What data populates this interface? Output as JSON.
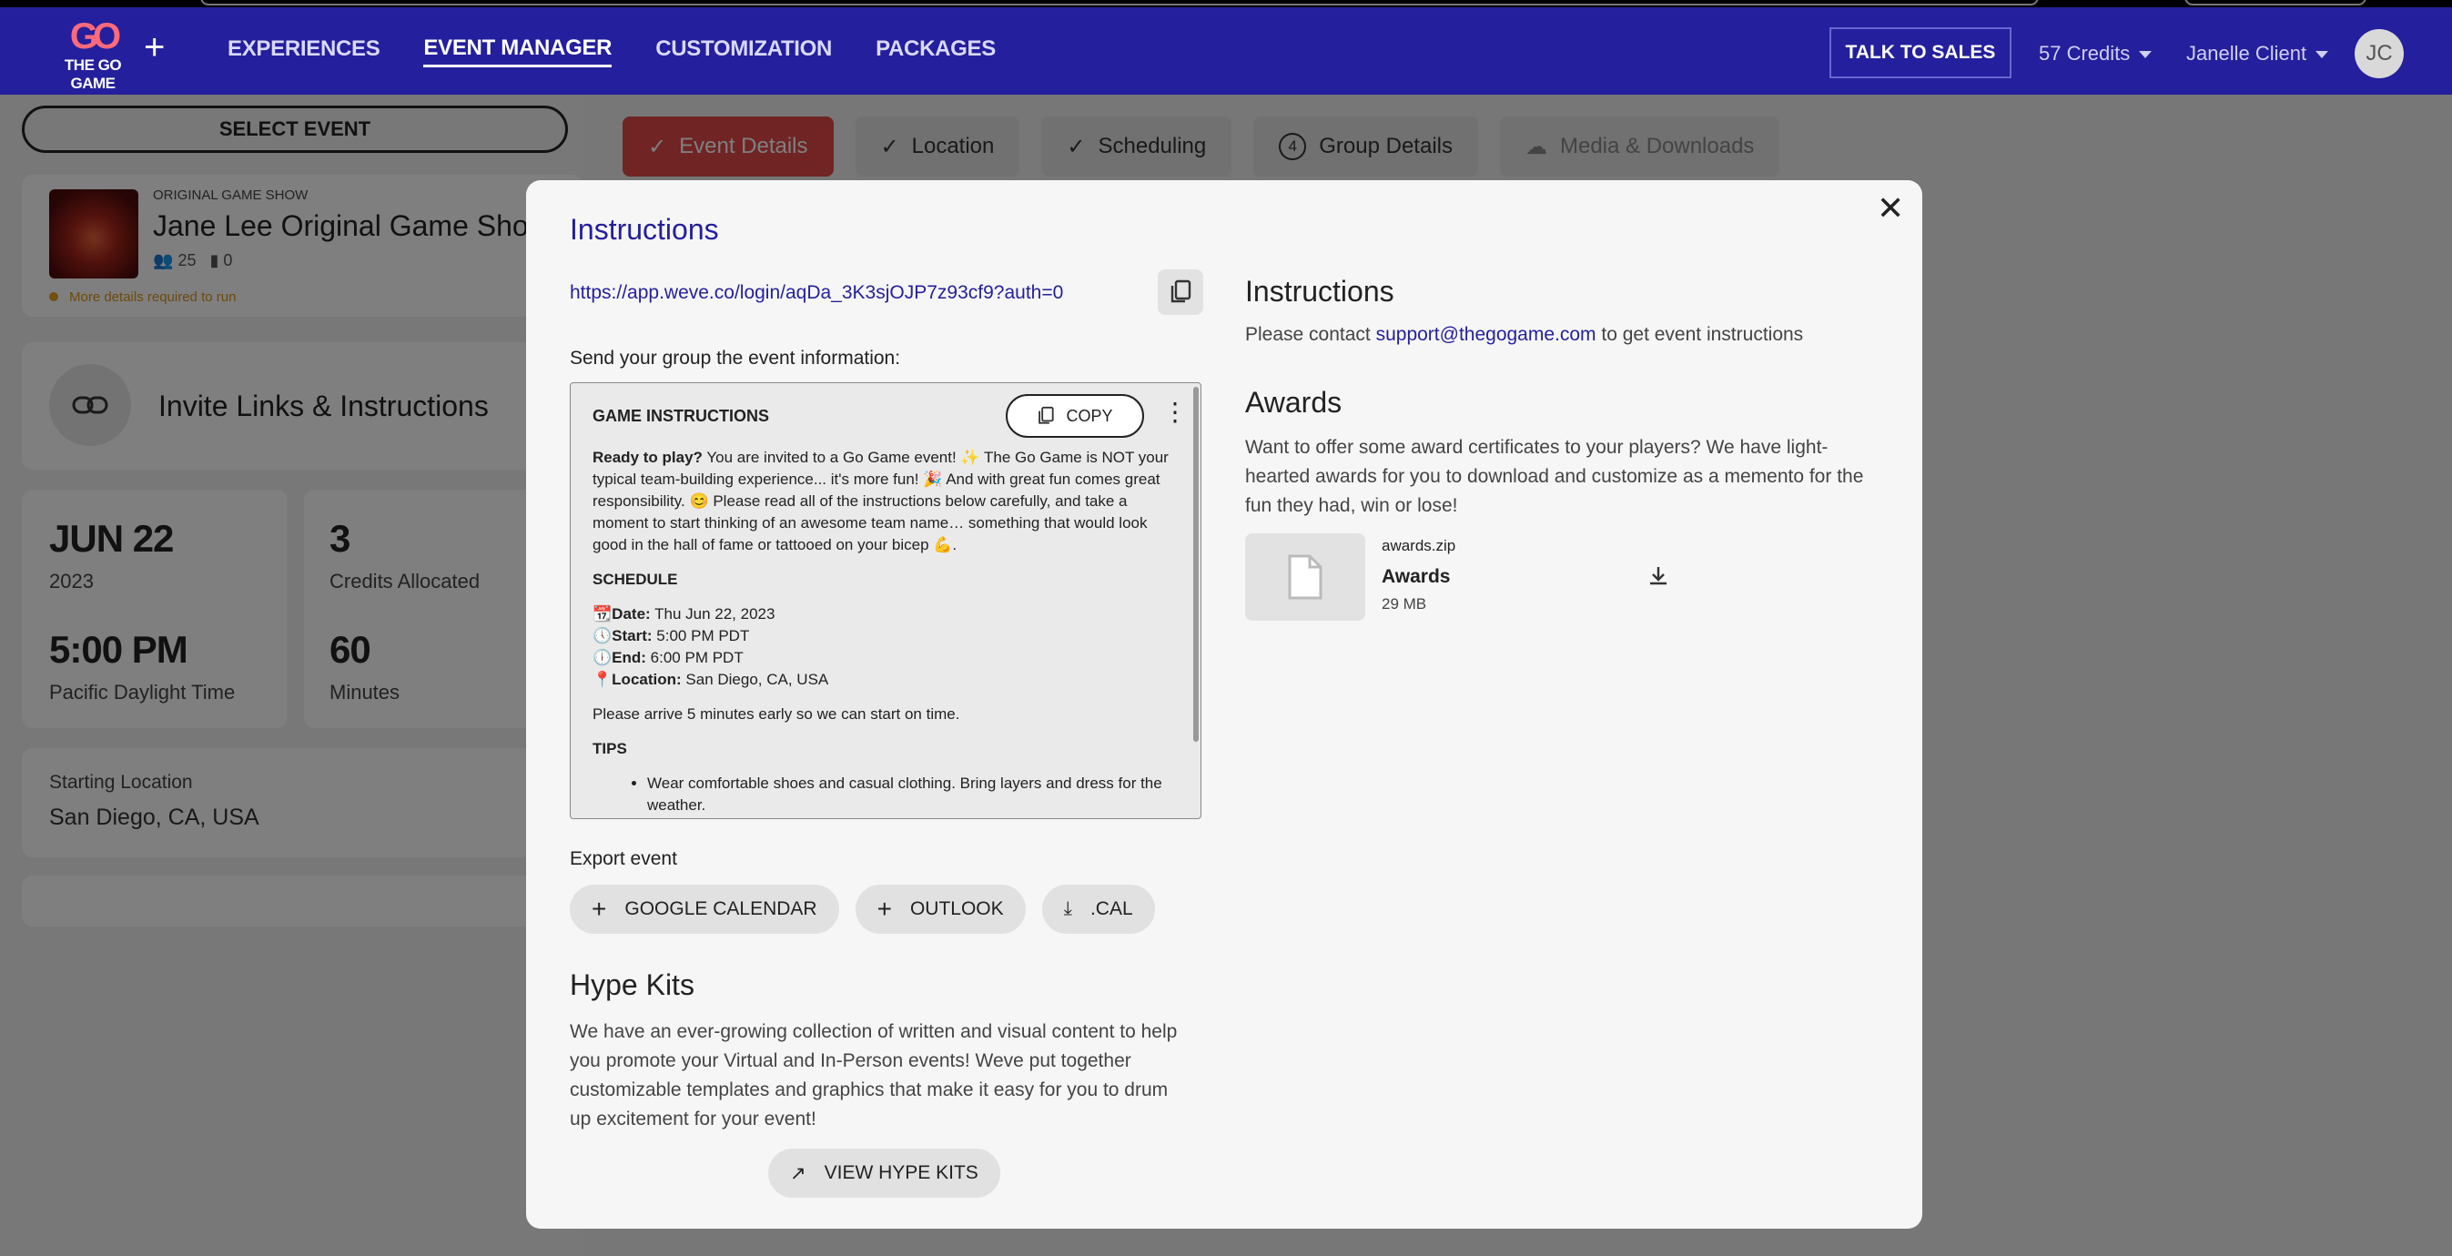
{
  "nav": {
    "logo_text": "THE GO GAME",
    "links": [
      "EXPERIENCES",
      "EVENT MANAGER",
      "CUSTOMIZATION",
      "PACKAGES"
    ],
    "talk_to_sales": "TALK TO SALES",
    "credits": "57 Credits",
    "user_name": "Janelle Client",
    "avatar_initials": "JC"
  },
  "sidebar": {
    "select_event": "SELECT EVENT",
    "event": {
      "category": "ORIGINAL GAME SHOW",
      "title": "Jane Lee Original Game Show",
      "players": "25",
      "teams": "0",
      "warning": "More details required to run"
    },
    "invite_title": "Invite Links & Instructions",
    "date": {
      "day": "JUN 22",
      "year": "2023",
      "time": "5:00 PM",
      "tz": "Pacific Daylight Time"
    },
    "credits": {
      "count": "3",
      "label": "Credits Allocated",
      "minutes": "60",
      "minutes_label": "Minutes"
    },
    "location": {
      "label": "Starting Location",
      "value": "San Diego, CA, USA"
    }
  },
  "tabs": [
    "Event Details",
    "Location",
    "Scheduling",
    "Group Details",
    "Media & Downloads"
  ],
  "tab_step_number": "4",
  "modal": {
    "title": "Instructions",
    "link": "https://app.weve.co/login/aqDa_3K3sjOJP7z93cf9?auth=0",
    "send_label": "Send your group the event information:",
    "instructions": {
      "heading": "GAME INSTRUCTIONS",
      "copy_label": "COPY",
      "intro_bold": "Ready to play?",
      "intro_text": " You are invited to a Go Game event! ✨ The Go Game is NOT your typical team-building experience... it's more fun! 🎉 And with great fun comes great responsibility. 😊 Please read all of the instructions below carefully, and take a moment to start thinking of an awesome team name… something that would look good in the hall of fame or tattooed on your bicep 💪.",
      "schedule_heading": "SCHEDULE",
      "date_label": "Date:",
      "date_value": " Thu Jun 22, 2023",
      "start_label": "Start:",
      "start_value": " 5:00 PM PDT",
      "end_label": "End:",
      "end_value": " 6:00 PM PDT",
      "location_label": "Location:",
      "location_value": " San Diego, CA, USA",
      "arrive": "Please arrive 5 minutes early so we can start on time.",
      "tips_heading": "TIPS",
      "tip1": "Wear comfortable shoes and casual clothing. Bring layers and dress for the weather."
    },
    "export_label": "Export event",
    "export_buttons": [
      "GOOGLE CALENDAR",
      "OUTLOOK",
      ".CAL"
    ],
    "hype_title": "Hype Kits",
    "hype_desc": "We have an ever-growing collection of written and visual content to help you promote your Virtual and In-Person events! Weve put together customizable templates and graphics that make it easy for you to drum up excitement for your event!",
    "hype_button": "VIEW HYPE KITS",
    "right_instr_title": "Instructions",
    "contact_pre": "Please contact ",
    "contact_email": "support@thegogame.com",
    "contact_post": " to get event instructions",
    "awards_title": "Awards",
    "awards_desc": "Want to offer some award certificates to your players? We have light-hearted awards for you to download and customize as a memento for the fun they had, win or lose!",
    "file": {
      "name": "awards.zip",
      "title": "Awards",
      "size": "29 MB"
    }
  }
}
